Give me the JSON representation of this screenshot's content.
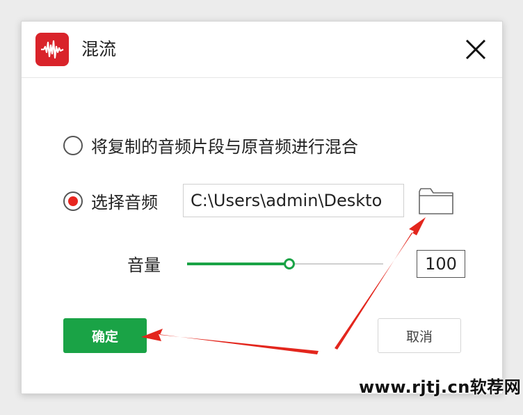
{
  "window": {
    "title": "混流",
    "app_icon": "audio-waveform-icon"
  },
  "options": {
    "mix_copied_label": "将复制的音频片段与原音频进行混合",
    "mix_copied_selected": false,
    "select_audio_label": "选择音频",
    "select_audio_selected": true,
    "file_path": "C:\\Users\\admin\\Deskto"
  },
  "volume": {
    "label": "音量",
    "value": "100",
    "slider_fraction": 0.52
  },
  "buttons": {
    "ok_label": "确定",
    "cancel_label": "取消"
  },
  "colors": {
    "accent_green": "#1aa346",
    "radio_red": "#e8261f",
    "app_icon_red": "#d9232a",
    "arrow_red": "#e3261d"
  },
  "watermark": {
    "text": "www.rjtj.cn软荐网"
  }
}
